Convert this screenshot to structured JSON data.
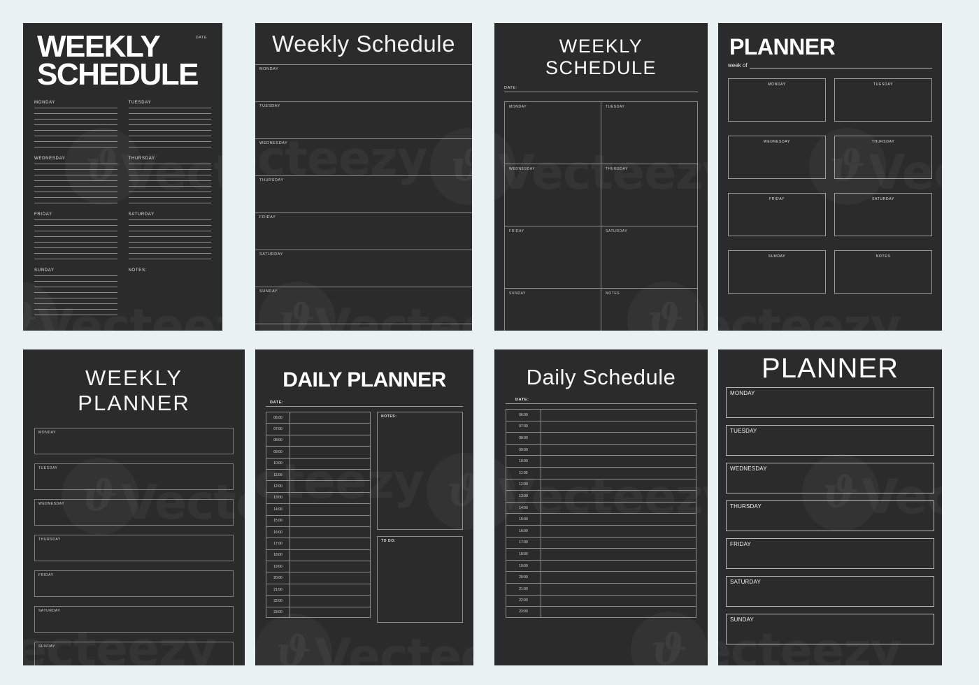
{
  "days": [
    "MONDAY",
    "TUESDAY",
    "WEDNESDAY",
    "THURSDAY",
    "FRIDAY",
    "SATURDAY",
    "SUNDAY"
  ],
  "colors": {
    "page_background": "#eaf1f2",
    "sheet_background": "#2b2b2b",
    "rule_line": "#8c8c8c",
    "text_primary": "#ffffff",
    "text_muted": "#d6d6d6"
  },
  "watermark": {
    "brand": "Vecteezy",
    "logo_glyph": "ϑ"
  },
  "panel1": {
    "title_line1": "WEEKLY",
    "title_line2": "SCHEDULE",
    "date_label": "DATE",
    "cells": [
      {
        "label": "MONDAY",
        "lines": 8
      },
      {
        "label": "TUESDAY",
        "lines": 8
      },
      {
        "label": "WEDNESDAY",
        "lines": 8
      },
      {
        "label": "THURSDAY",
        "lines": 8
      },
      {
        "label": "FRIDAY",
        "lines": 8
      },
      {
        "label": "SATURDAY",
        "lines": 8
      },
      {
        "label": "SUNDAY",
        "lines": 8
      },
      {
        "label": "NOTES:",
        "lines": 0
      }
    ]
  },
  "panel2": {
    "title": "Weekly Schedule",
    "rows": [
      "MONDAY",
      "TUESDAY",
      "WEDNESDAY",
      "THURSDAY",
      "FRIDAY",
      "SATURDAY",
      "SUNDAY"
    ]
  },
  "panel3": {
    "title": "WEEKLY SCHEDULE",
    "date_label": "DATE:",
    "boxes": [
      "MONDAY",
      "TUESDAY",
      "WEDNESDAY",
      "THURSDAY",
      "FRIDAY",
      "SATURDAY",
      "SUNDAY",
      "NOTES"
    ]
  },
  "panel4": {
    "title": "PLANNER",
    "week_of_label": "week of",
    "boxes": [
      "MONDAY",
      "TUESDAY",
      "WEDNESDAY",
      "THURSDAY",
      "FRIDAY",
      "SATURDAY",
      "SUNDAY",
      "NOTES"
    ]
  },
  "panel5": {
    "title": "WEEKLY PLANNER",
    "boxes": [
      "MONDAY",
      "TUESDAY",
      "WEDNESDAY",
      "THURSDAY",
      "FRIDAY",
      "SATURDAY",
      "SUNDAY"
    ]
  },
  "panel6": {
    "title": "DAILY PLANNER",
    "date_label": "DATE:",
    "notes_label": "NOTES:",
    "todo_label": "TO DO:",
    "times": [
      "06:00",
      "07:00",
      "08:00",
      "09:00",
      "10:00",
      "11:00",
      "12:00",
      "13:00",
      "14:00",
      "15:00",
      "16:00",
      "17:00",
      "18:00",
      "19:00",
      "20:00",
      "21:00",
      "22:00",
      "23:00"
    ]
  },
  "panel7": {
    "title": "Daily Schedule",
    "date_label": "DATE:",
    "times": [
      "06:00",
      "07:00",
      "08:00",
      "09:00",
      "10:00",
      "11:00",
      "12:00",
      "13:00",
      "14:00",
      "15:00",
      "16:00",
      "17:00",
      "18:00",
      "19:00",
      "20:00",
      "21:00",
      "22:00",
      "23:00"
    ]
  },
  "panel8": {
    "title": "PLANNER",
    "boxes": [
      "MONDAY",
      "TUESDAY",
      "WEDNESDAY",
      "THURSDAY",
      "FRIDAY",
      "SATURDAY",
      "SUNDAY"
    ]
  }
}
